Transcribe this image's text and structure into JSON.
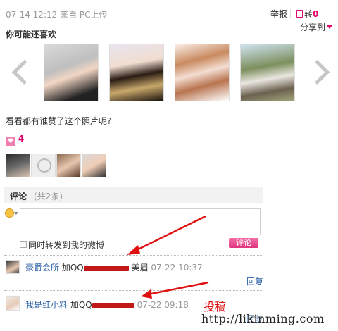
{
  "post": {
    "meta": "07-14 12:12 来自 PC上传",
    "report": "举报",
    "repost_label": "转",
    "repost_count": "0",
    "share": "分享到"
  },
  "recommend": {
    "title": "你可能还喜欢"
  },
  "likes": {
    "question": "看看都有谁赞了这个照片呢?",
    "count": "4"
  },
  "comments": {
    "title": "评论",
    "count_text": "(共2条)",
    "forward_label": "同时转发到我的微博",
    "submit": "评论",
    "items": [
      {
        "user": "豪爵会所",
        "prefix": "加QQ",
        "suffix": "美眉",
        "time": "07-22 10:37",
        "reply": "回复"
      },
      {
        "user": "我是红小料",
        "prefix": "加QQ",
        "time": "07-22 09:18",
        "reply": "回复"
      }
    ]
  },
  "overlay": {
    "caption": "投稿",
    "watermark": "http://likinming.com"
  },
  "colors": {
    "accent": "#e0006e",
    "link": "#2b5fa8",
    "annotation": "#e01010"
  }
}
